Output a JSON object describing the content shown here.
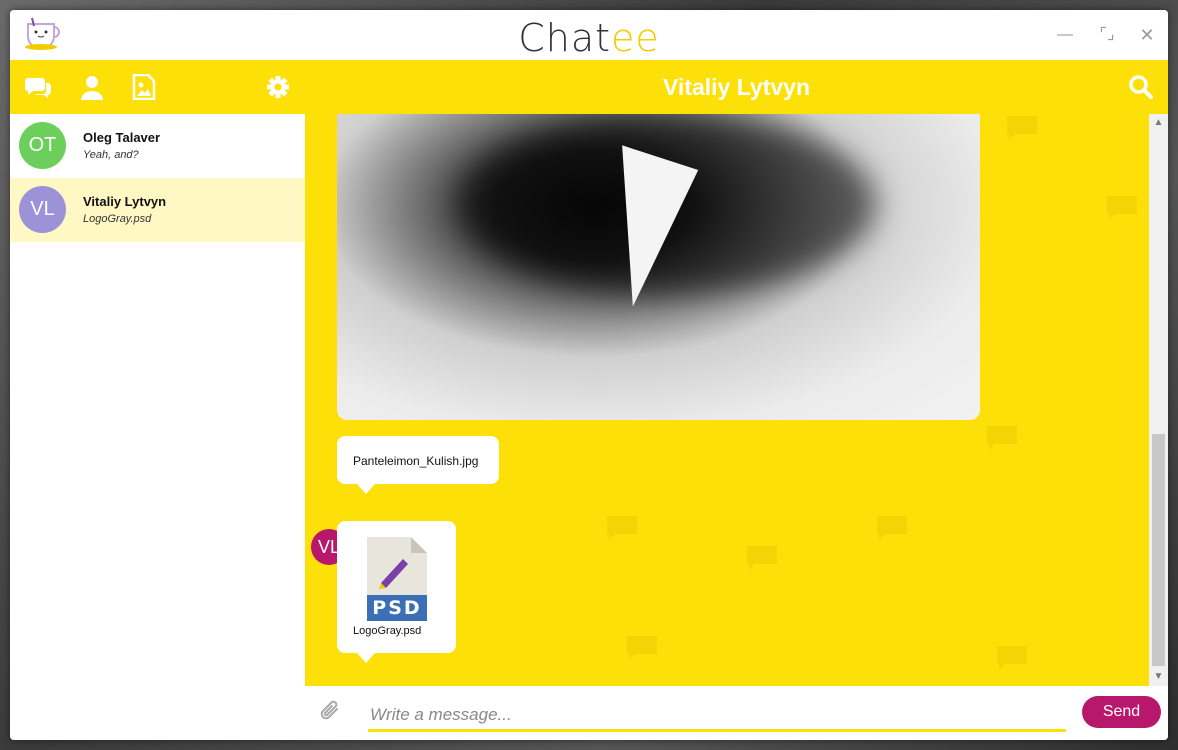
{
  "window": {
    "title_main": "Chat",
    "title_accent": "ee",
    "minimize_glyph": "—",
    "maximize_glyph": "⌜⌟",
    "close_glyph": "✕"
  },
  "header": {
    "title": "Vitaliy Lytvyn",
    "icons": [
      "chats-icon",
      "contacts-icon",
      "images-icon",
      "settings-icon",
      "search-icon"
    ]
  },
  "contacts": [
    {
      "initials": "OT",
      "name": "Oleg Talaver",
      "last_message": "Yeah, and?",
      "avatar_color": "#6cce5b"
    },
    {
      "initials": "VL",
      "name": "Vitaliy Lytvyn",
      "last_message": "LogoGray.psd",
      "avatar_color": "#9c92d8",
      "selected": true
    }
  ],
  "messages": {
    "sender_initials": "VL",
    "sender_color": "#b8186b",
    "file1_name": "Panteleimon_Kulish.jpg",
    "file2_name": "LogoGray.psd",
    "file2_type": "PSD"
  },
  "input": {
    "placeholder": "Write a message...",
    "value": "",
    "send_label": "Send"
  },
  "colors": {
    "accent": "#fde007",
    "brand": "#b8186b",
    "selected_row": "#fff8c4"
  },
  "scroll": {
    "arrow_up": "▲",
    "arrow_down": "▼"
  }
}
